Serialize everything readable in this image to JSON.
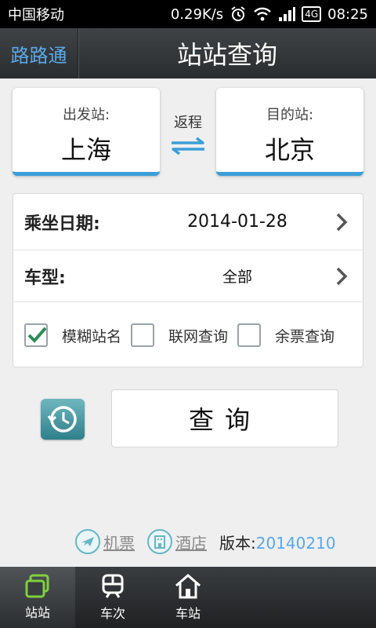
{
  "status_bar": {
    "carrier": "中国移动",
    "speed": "0.29K/s",
    "time": "08:25",
    "network": "4G"
  },
  "title_bar": {
    "back_label": "路路通",
    "title": "站站查询"
  },
  "stations": {
    "from_label": "出发站:",
    "from_value": "上海",
    "swap_label": "返程",
    "to_label": "目的站:",
    "to_value": "北京"
  },
  "options": {
    "date_label": "乘坐日期:",
    "date_value": "2014-01-28",
    "train_type_label": "车型:",
    "train_type_value": "全部",
    "checkboxes": [
      {
        "label": "模糊站名",
        "checked": true
      },
      {
        "label": "联网查询",
        "checked": false
      },
      {
        "label": "余票查询",
        "checked": false
      }
    ]
  },
  "query_button": "查询",
  "footer": {
    "flight_link": "机票",
    "hotel_link": "酒店",
    "version_label": "版本:",
    "version_value": "20140210"
  },
  "tabs": [
    {
      "label": "站站",
      "icon": "station-to-station-icon",
      "active": true
    },
    {
      "label": "车次",
      "icon": "train-icon",
      "active": false
    },
    {
      "label": "车站",
      "icon": "home-icon",
      "active": false
    }
  ],
  "colors": {
    "accent": "#3b9ed8",
    "link": "#5aa8e8",
    "check": "#2e8b57"
  }
}
